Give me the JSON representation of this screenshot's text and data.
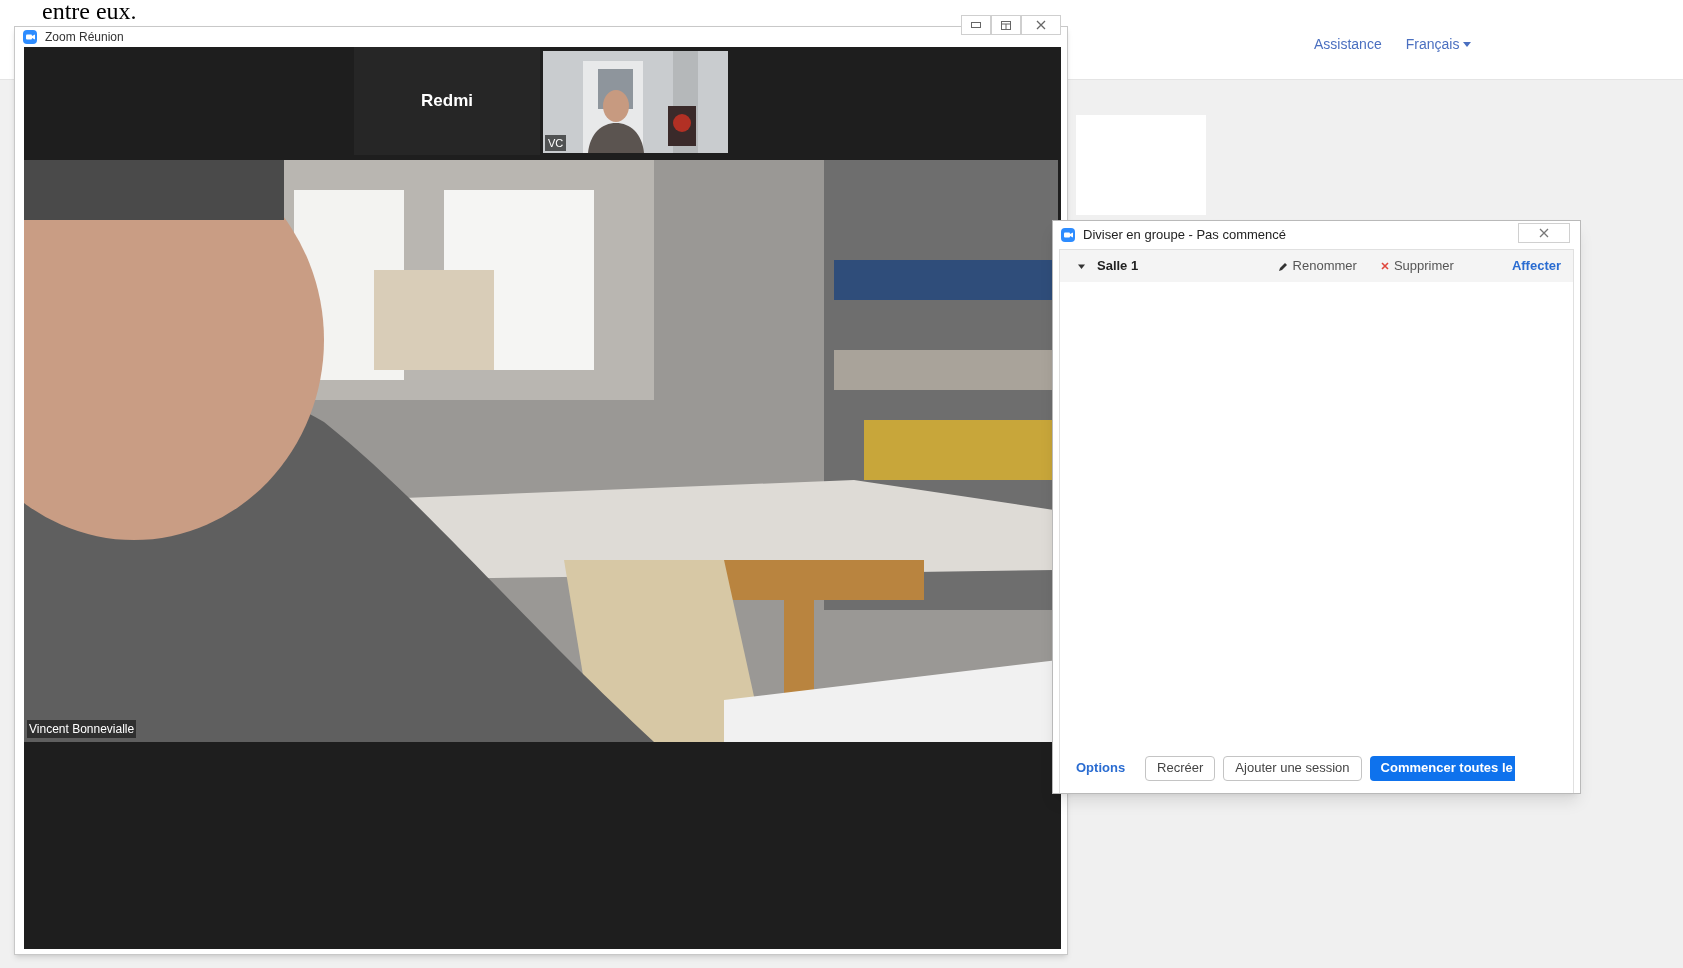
{
  "document_text": "entre eux.",
  "site_header": {
    "links": [
      {
        "label": "Assistance",
        "kind": "link"
      },
      {
        "label": "Français",
        "kind": "dropdown"
      }
    ]
  },
  "meeting_window": {
    "title": "Zoom Réunion",
    "participants": [
      {
        "name": "Redmi",
        "kind": "name_tile"
      },
      {
        "name": "VC",
        "kind": "video"
      }
    ],
    "speaker": {
      "name": "Vincent Bonnevialle"
    }
  },
  "breakout_dialog": {
    "title": "Diviser en groupe - Pas commencé",
    "rooms": [
      {
        "name": "Salle 1",
        "expanded": true,
        "actions": [
          {
            "label": "Renommer",
            "kind": "rename"
          },
          {
            "label": "Supprimer",
            "kind": "delete"
          },
          {
            "label": "Affecter",
            "kind": "assign"
          }
        ]
      }
    ],
    "buttons": [
      {
        "label": "Options",
        "kind": "link"
      },
      {
        "label": "Recréer",
        "kind": "outline"
      },
      {
        "label": "Ajouter une session",
        "kind": "outline"
      },
      {
        "label": "Commencer toutes le",
        "kind": "primary"
      }
    ]
  }
}
